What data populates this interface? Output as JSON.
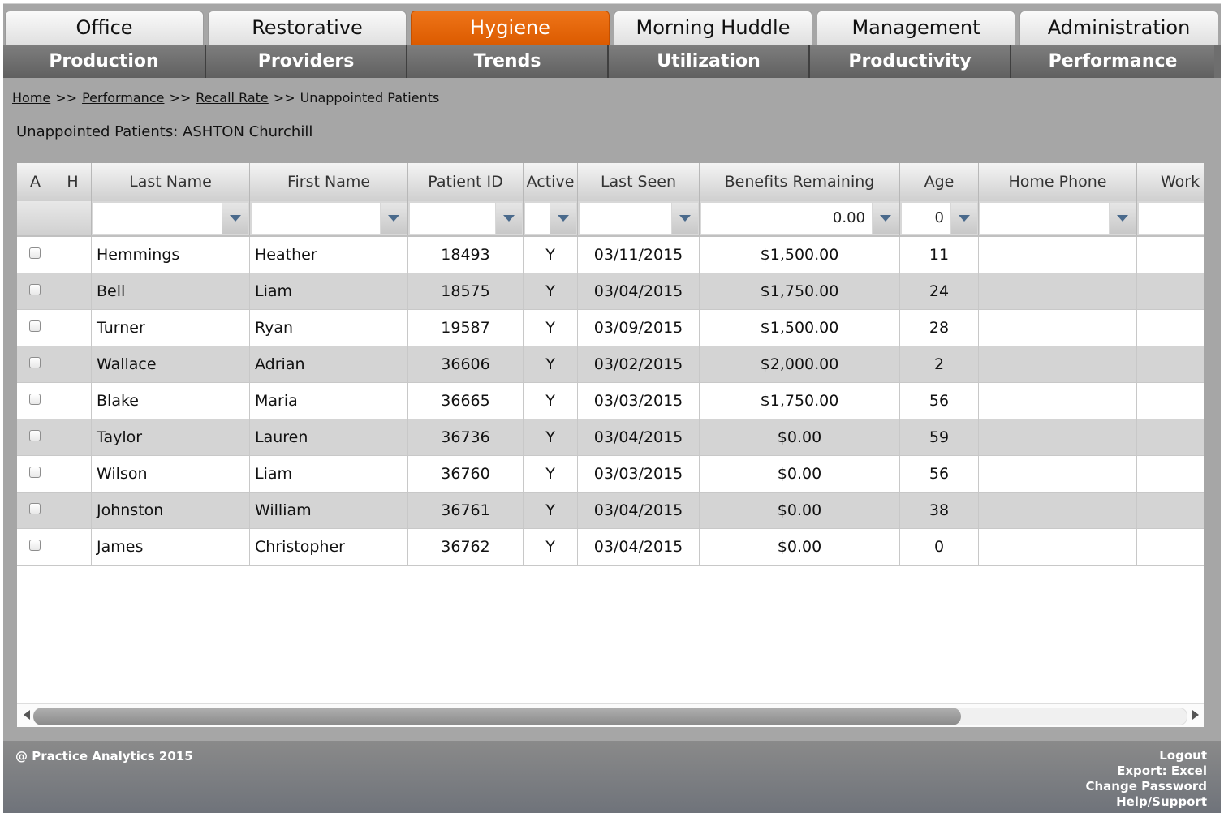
{
  "main_tabs": [
    "Office",
    "Restorative",
    "Hygiene",
    "Morning Huddle",
    "Management",
    "Administration"
  ],
  "active_main_tab": "Hygiene",
  "sub_tabs": [
    "Production",
    "Providers",
    "Trends",
    "Utilization",
    "Productivity",
    "Performance"
  ],
  "breadcrumb": {
    "home": "Home",
    "performance": "Performance",
    "recall_rate": "Recall Rate",
    "current": "Unappointed Patients",
    "separator": ">>"
  },
  "page_title": "Unappointed Patients: ASHTON Churchill",
  "table": {
    "columns": [
      "A",
      "H",
      "Last Name",
      "First Name",
      "Patient ID",
      "Active",
      "Last Seen",
      "Benefits Remaining",
      "Age",
      "Home Phone",
      "Work Phone"
    ],
    "filters": {
      "benefits_remaining": "0.00",
      "age": "0"
    },
    "rows": [
      {
        "last": "Hemmings",
        "first": "Heather",
        "id": "18493",
        "active": "Y",
        "seen": "03/11/2015",
        "benefits": "$1,500.00",
        "age": "11"
      },
      {
        "last": "Bell",
        "first": "Liam",
        "id": "18575",
        "active": "Y",
        "seen": "03/04/2015",
        "benefits": "$1,750.00",
        "age": "24"
      },
      {
        "last": "Turner",
        "first": "Ryan",
        "id": "19587",
        "active": "Y",
        "seen": "03/09/2015",
        "benefits": "$1,500.00",
        "age": "28"
      },
      {
        "last": "Wallace",
        "first": "Adrian",
        "id": "36606",
        "active": "Y",
        "seen": "03/02/2015",
        "benefits": "$2,000.00",
        "age": "2"
      },
      {
        "last": "Blake",
        "first": "Maria",
        "id": "36665",
        "active": "Y",
        "seen": "03/03/2015",
        "benefits": "$1,750.00",
        "age": "56"
      },
      {
        "last": "Taylor",
        "first": "Lauren",
        "id": "36736",
        "active": "Y",
        "seen": "03/04/2015",
        "benefits": "$0.00",
        "age": "59"
      },
      {
        "last": "Wilson",
        "first": "Liam",
        "id": "36760",
        "active": "Y",
        "seen": "03/03/2015",
        "benefits": "$0.00",
        "age": "56"
      },
      {
        "last": "Johnston",
        "first": "William",
        "id": "36761",
        "active": "Y",
        "seen": "03/04/2015",
        "benefits": "$0.00",
        "age": "38"
      },
      {
        "last": "James",
        "first": "Christopher",
        "id": "36762",
        "active": "Y",
        "seen": "03/04/2015",
        "benefits": "$0.00",
        "age": "0"
      }
    ]
  },
  "footer": {
    "copyright": "@ Practice Analytics 2015",
    "logout": "Logout",
    "export": "Export: Excel",
    "change_password": "Change Password",
    "help": "Help/Support"
  },
  "colors": {
    "active_tab": "#e86a10",
    "sub_tab_bg": "#6e6e6e",
    "frame_bg": "#a6a6a6"
  }
}
